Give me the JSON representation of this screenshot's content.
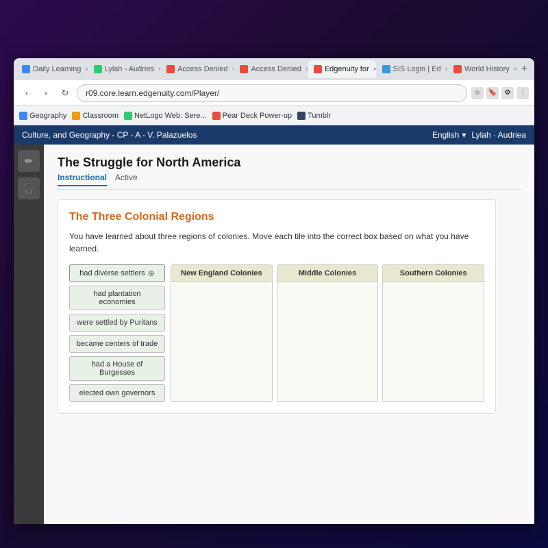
{
  "desktop": {
    "bg_color": "#1a0a2e"
  },
  "browser": {
    "tabs": [
      {
        "label": "Daily Learning",
        "icon_color": "#4285f4",
        "active": false,
        "closable": true
      },
      {
        "label": "Lylah - Audries",
        "icon_color": "#2ecc71",
        "active": false,
        "closable": true
      },
      {
        "label": "Access Denied",
        "icon_color": "#e74c3c",
        "active": false,
        "closable": true
      },
      {
        "label": "Access Denied",
        "icon_color": "#e74c3c",
        "active": false,
        "closable": true
      },
      {
        "label": "Edgenuity for",
        "icon_color": "#e74c3c",
        "active": true,
        "closable": true
      },
      {
        "label": "SIS Login | Ed",
        "icon_color": "#3498db",
        "active": false,
        "closable": true
      },
      {
        "label": "World History",
        "icon_color": "#e74c3c",
        "active": false,
        "closable": true
      }
    ],
    "url": "r09.core.learn.edgenuity.com/Player/",
    "bookmarks": [
      {
        "label": "Geography",
        "icon_color": "#4285f4"
      },
      {
        "label": "Classroom",
        "icon_color": "#f39c12"
      },
      {
        "label": "NetLogo Web: Sere...",
        "icon_color": "#2ecc71"
      },
      {
        "label": "Pear Deck Power-up",
        "icon_color": "#e74c3c"
      },
      {
        "label": "Tumblr",
        "icon_color": "#34495e"
      }
    ]
  },
  "edgenuity": {
    "topbar_title": "Culture, and Geography - CP - A - V. Palazuelos",
    "language_label": "English",
    "user_label": "Lylah · Audriea",
    "lesson": {
      "title": "The Struggle for North America",
      "tabs": [
        {
          "label": "Instructional",
          "active": true
        },
        {
          "label": "Active",
          "active": false
        }
      ],
      "activity_title": "The Three Colonial Regions",
      "instructions": "You have learned about three regions of colonies. Move each tile into the correct box based on what you have learned.",
      "tiles": [
        {
          "text": "had diverse settlers",
          "selected": true
        },
        {
          "text": "had plantation economies"
        },
        {
          "text": "were settled by Puritans"
        },
        {
          "text": "became centers of trade"
        },
        {
          "text": "had a House of Burgesses"
        },
        {
          "text": "elected own governors"
        }
      ],
      "columns": [
        {
          "header": "New England Colonies"
        },
        {
          "header": "Middle Colonies"
        },
        {
          "header": "Southern Colonies"
        }
      ]
    }
  },
  "sidebar": {
    "icons": [
      {
        "name": "pencil",
        "symbol": "✏"
      },
      {
        "name": "headphone",
        "symbol": "🎧"
      }
    ]
  }
}
